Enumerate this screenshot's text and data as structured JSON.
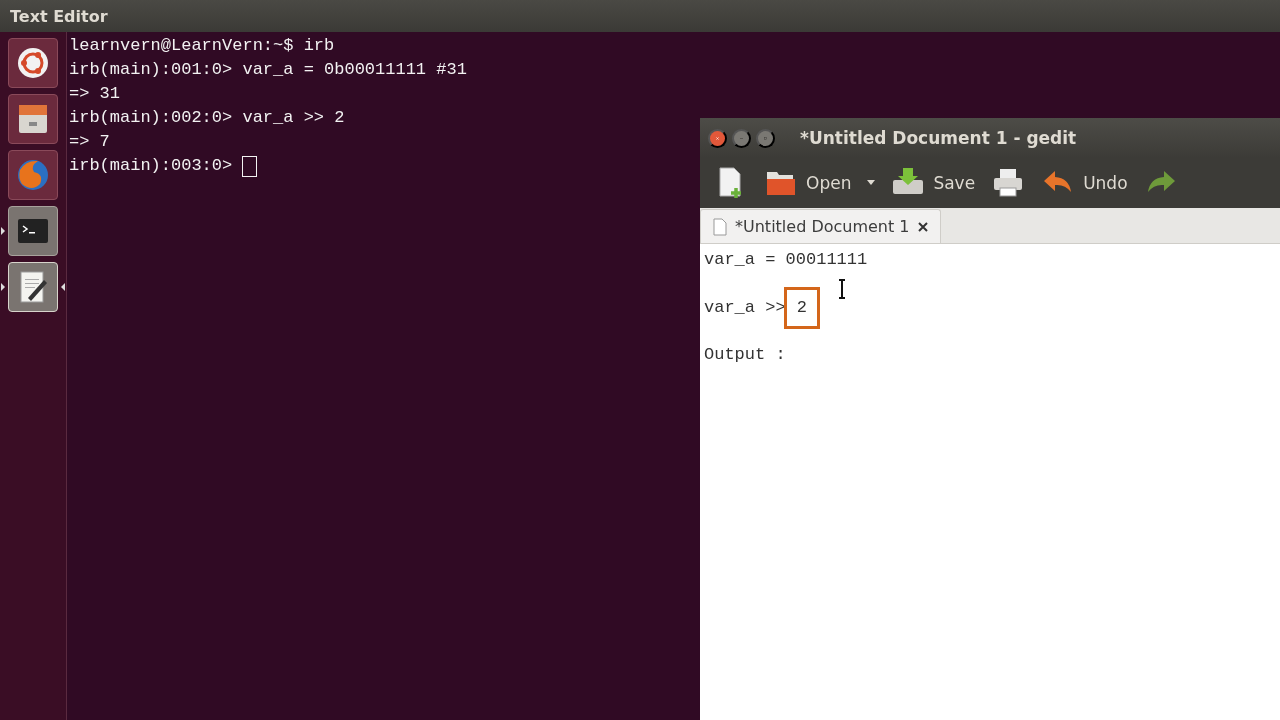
{
  "top_bar": {
    "title": "Text Editor"
  },
  "launcher": [
    {
      "kind": "dash",
      "running": false,
      "focused": false
    },
    {
      "kind": "files",
      "running": false,
      "focused": false
    },
    {
      "kind": "browser",
      "running": false,
      "focused": false
    },
    {
      "kind": "terminal",
      "running": true,
      "focused": false
    },
    {
      "kind": "editor",
      "running": true,
      "focused": true
    }
  ],
  "terminal": {
    "lines": [
      "learnvern@LearnVern:~$ irb",
      "irb(main):001:0> var_a = 0b00011111 #31",
      "=> 31",
      "irb(main):002:0> var_a >> 2",
      "=> 7",
      "irb(main):003:0> "
    ],
    "cursor": true
  },
  "gedit": {
    "title": "*Untitled Document 1 - gedit",
    "toolbar": [
      {
        "kind": "new"
      },
      {
        "kind": "open",
        "label": "Open",
        "dropdown": true
      },
      {
        "kind": "save",
        "label": "Save"
      },
      {
        "kind": "print"
      },
      {
        "kind": "undo",
        "label": "Undo"
      },
      {
        "kind": "redo"
      }
    ],
    "tabs": [
      {
        "label": "*Untitled Document 1",
        "selected": true
      }
    ],
    "lines": [
      {
        "text": "var_a = 00011111"
      },
      {
        "text": "var_a >>",
        "highlight": "2"
      },
      {
        "text": "Output :"
      }
    ]
  }
}
